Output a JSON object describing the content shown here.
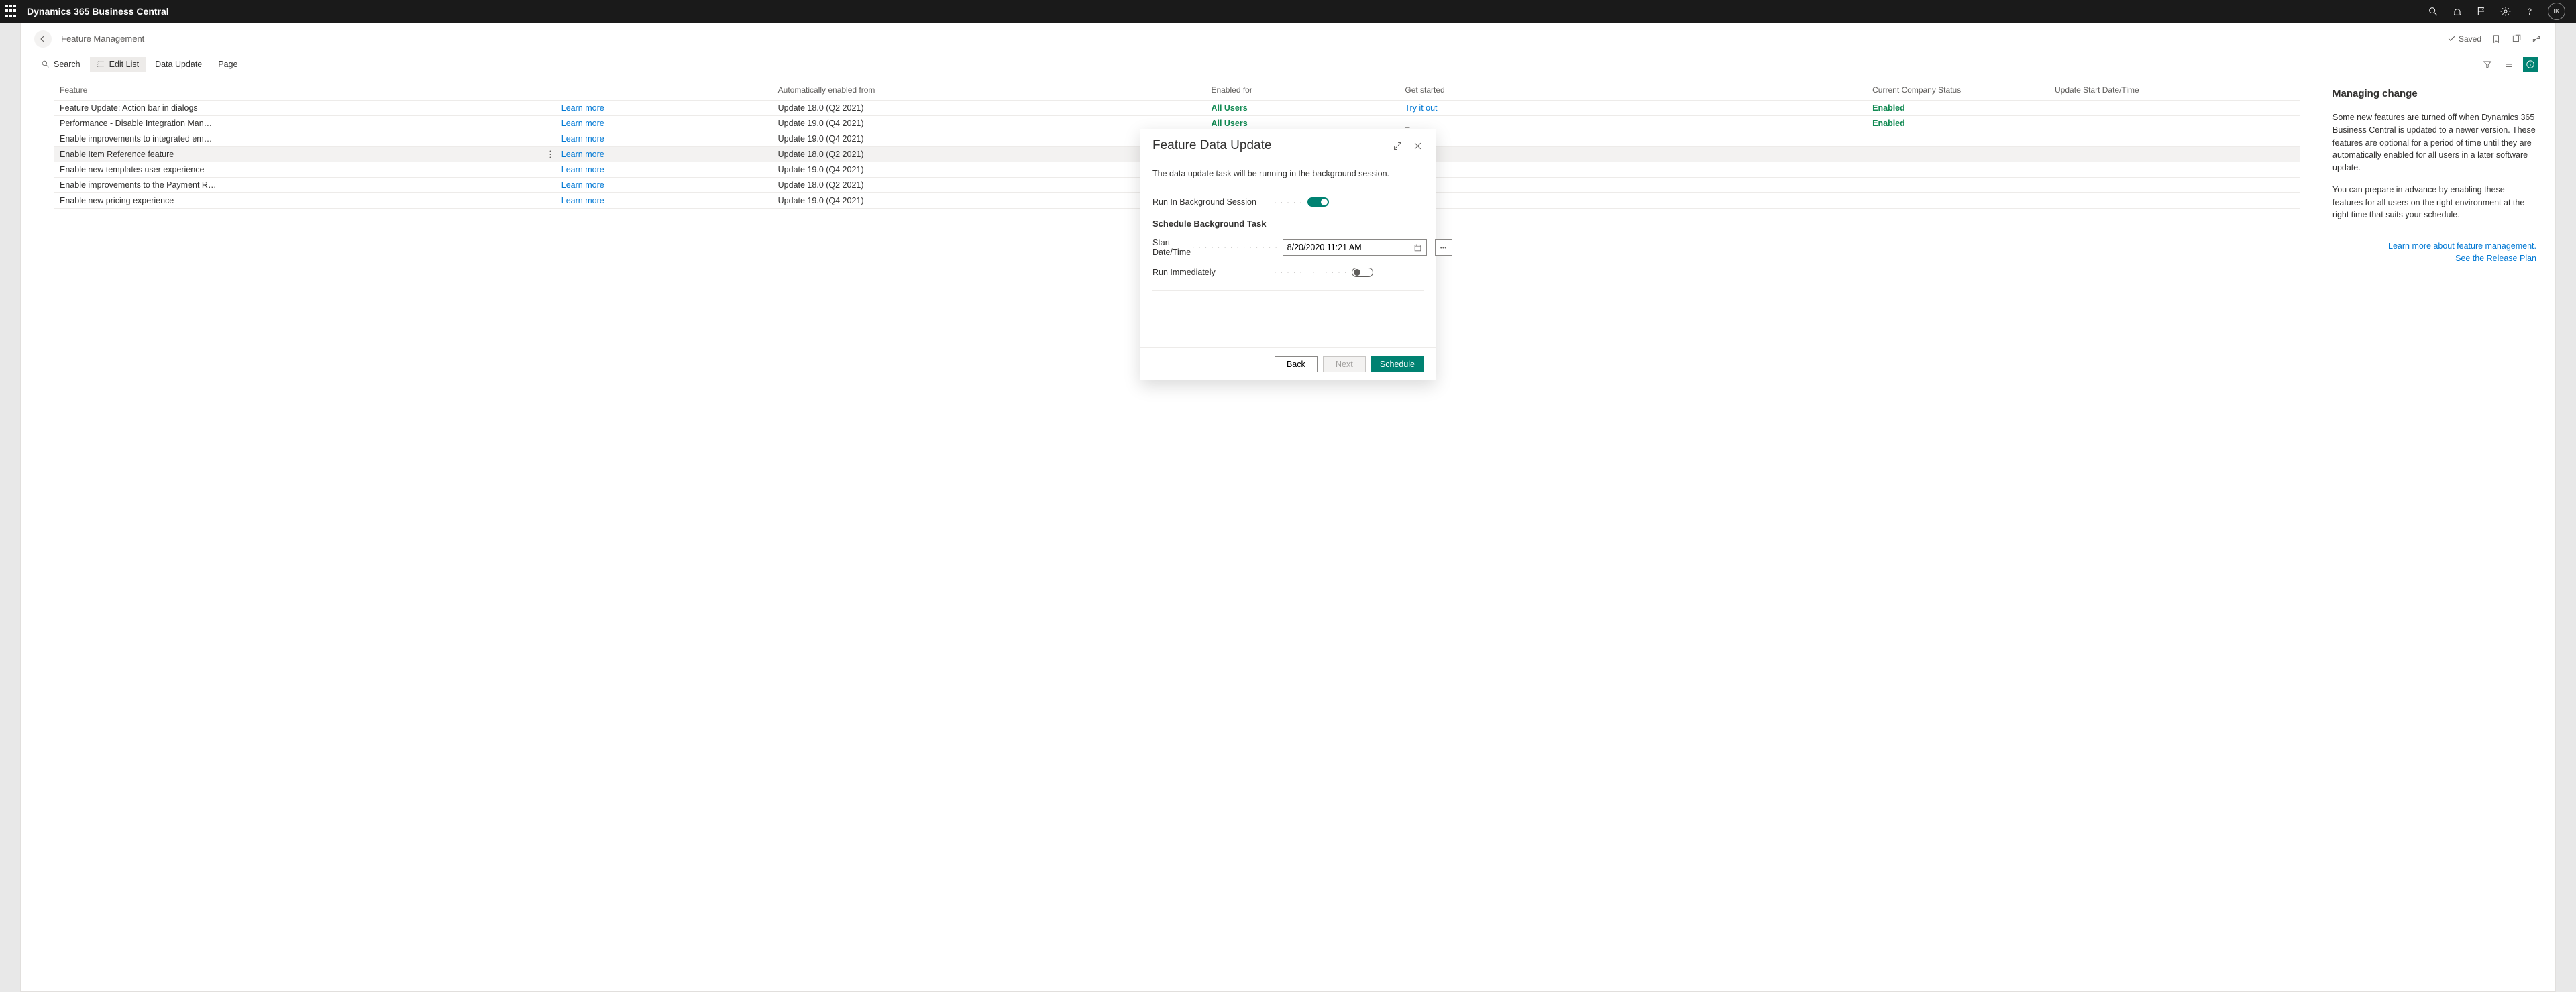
{
  "header": {
    "app_name": "Dynamics 365 Business Central",
    "avatar_initials": "IK"
  },
  "page": {
    "title": "Feature Management",
    "saved_label": "Saved"
  },
  "actions": {
    "search": "Search",
    "edit_list": "Edit List",
    "data_update": "Data Update",
    "page": "Page"
  },
  "columns": {
    "feature": "Feature",
    "auto_enabled": "Automatically enabled from",
    "enabled_for": "Enabled for",
    "get_started": "Get started",
    "current_status": "Current Company Status",
    "update_start": "Update Start Date/Time"
  },
  "learn_more": "Learn more",
  "rows": [
    {
      "feature": "Feature Update: Action bar in dialogs",
      "auto": "Update 18.0 (Q2 2021)",
      "enabled_for": "All Users",
      "get_started": "Try it out",
      "status": "Enabled"
    },
    {
      "feature": "Performance - Disable Integration Man…",
      "auto": "Update 19.0 (Q4 2021)",
      "enabled_for": "All Users",
      "get_started": "_",
      "status": "Enabled"
    },
    {
      "feature": "Enable improvements to integrated em…",
      "auto": "Update 19.0 (Q4 2021)",
      "enabled_for": "",
      "get_started": "",
      "status": ""
    },
    {
      "feature": "Enable Item Reference feature",
      "auto": "Update 18.0 (Q2 2021)",
      "enabled_for": "",
      "get_started": "",
      "status": "",
      "selected": true
    },
    {
      "feature": "Enable new templates user experience",
      "auto": "Update 19.0 (Q4 2021)",
      "enabled_for": "",
      "get_started": "",
      "status": ""
    },
    {
      "feature": "Enable improvements to the Payment R…",
      "auto": "Update 18.0 (Q2 2021)",
      "enabled_for": "",
      "get_started": "",
      "status": ""
    },
    {
      "feature": "Enable new pricing experience",
      "auto": "Update 19.0 (Q4 2021)",
      "enabled_for": "",
      "get_started": "",
      "status": ""
    }
  ],
  "info": {
    "heading": "Managing change",
    "p1": "Some new features are turned off when Dynamics 365 Business Central is updated to a newer version. These features are optional for a period of time until they are automatically enabled for all users in a later software update.",
    "p2": "You can prepare in advance by enabling these features for all users on the right environment at the right time that suits your schedule.",
    "link1": "Learn more about feature management.",
    "link2": "See the Release Plan"
  },
  "dialog": {
    "title": "Feature Data Update",
    "note": "The data update task will be running in the background session.",
    "run_bg_label": "Run In Background Session",
    "section": "Schedule Background Task",
    "start_label": "Start Date/Time",
    "start_value": "8/20/2020 11:21 AM",
    "run_imm_label": "Run Immediately",
    "back": "Back",
    "next": "Next",
    "schedule": "Schedule"
  }
}
